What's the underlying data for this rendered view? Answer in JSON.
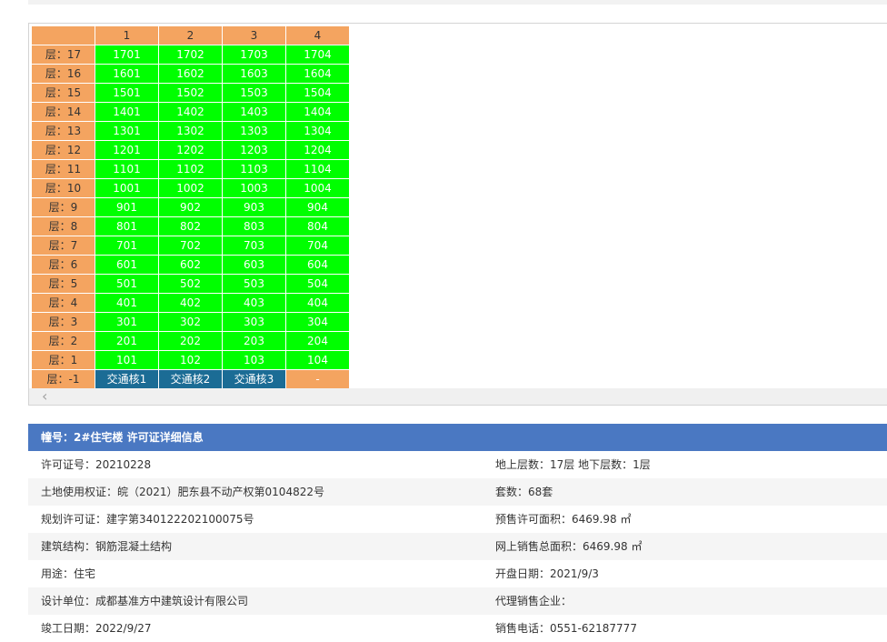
{
  "grid": {
    "columns": [
      "",
      "1",
      "2",
      "3",
      "4"
    ],
    "rows": [
      {
        "floor": "层：17",
        "units": [
          "1701",
          "1702",
          "1703",
          "1704"
        ]
      },
      {
        "floor": "层：16",
        "units": [
          "1601",
          "1602",
          "1603",
          "1604"
        ]
      },
      {
        "floor": "层：15",
        "units": [
          "1501",
          "1502",
          "1503",
          "1504"
        ]
      },
      {
        "floor": "层：14",
        "units": [
          "1401",
          "1402",
          "1403",
          "1404"
        ]
      },
      {
        "floor": "层：13",
        "units": [
          "1301",
          "1302",
          "1303",
          "1304"
        ]
      },
      {
        "floor": "层：12",
        "units": [
          "1201",
          "1202",
          "1203",
          "1204"
        ]
      },
      {
        "floor": "层：11",
        "units": [
          "1101",
          "1102",
          "1103",
          "1104"
        ]
      },
      {
        "floor": "层：10",
        "units": [
          "1001",
          "1002",
          "1003",
          "1004"
        ]
      },
      {
        "floor": "层：9",
        "units": [
          "901",
          "902",
          "903",
          "904"
        ]
      },
      {
        "floor": "层：8",
        "units": [
          "801",
          "802",
          "803",
          "804"
        ]
      },
      {
        "floor": "层：7",
        "units": [
          "701",
          "702",
          "703",
          "704"
        ]
      },
      {
        "floor": "层：6",
        "units": [
          "601",
          "602",
          "603",
          "604"
        ]
      },
      {
        "floor": "层：5",
        "units": [
          "501",
          "502",
          "503",
          "504"
        ]
      },
      {
        "floor": "层：4",
        "units": [
          "401",
          "402",
          "403",
          "404"
        ]
      },
      {
        "floor": "层：3",
        "units": [
          "301",
          "302",
          "303",
          "304"
        ]
      },
      {
        "floor": "层：2",
        "units": [
          "201",
          "202",
          "203",
          "204"
        ]
      },
      {
        "floor": "层：1",
        "units": [
          "101",
          "102",
          "103",
          "104"
        ]
      }
    ],
    "basement": {
      "floor": "层：-1",
      "units": [
        "交通核1",
        "交通核2",
        "交通核3",
        "-"
      ]
    }
  },
  "scroll": {
    "left_arrow": "‹"
  },
  "info": {
    "header": "幢号：2#住宅楼 许可证详细信息",
    "rows": [
      [
        "许可证号：20210228",
        "地上层数：17层  地下层数：1层"
      ],
      [
        "土地使用权证：皖（2021）肥东县不动产权第0104822号",
        "套数：68套"
      ],
      [
        "规划许可证：建字第340122202100075号",
        "预售许可面积：6469.98 ㎡"
      ],
      [
        "建筑结构：钢筋混凝土结构",
        "网上销售总面积：6469.98 ㎡"
      ],
      [
        "用途：住宅",
        "开盘日期：2021/9/3"
      ],
      [
        "设计单位：成都基准方中建筑设计有限公司",
        "代理销售企业："
      ],
      [
        "竣工日期：2022/9/27",
        "销售电话：0551-62187777"
      ]
    ]
  },
  "colors": {
    "unit_available": "#00ff00",
    "floor_header": "#f4a460",
    "core": "#1b6c95",
    "info_header": "#4a78c2"
  }
}
